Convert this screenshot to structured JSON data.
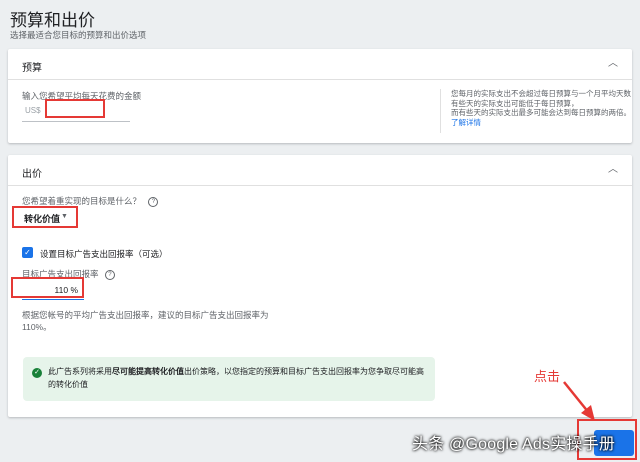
{
  "header": {
    "title": "预算和出价",
    "subtitle": "选择最适合您目标的预算和出价选项"
  },
  "budget": {
    "section_title": "预算",
    "prompt": "输入您希望平均每天花费的金额",
    "currency": "US$",
    "amount_value": "",
    "info_lines": [
      "您每月的实际支出不会超过每日预算与一个月平均天数",
      "有些天的实际支出可能低于每日预算，",
      "而有些天的实际支出最多可能会达到每日预算的两倍。"
    ],
    "learn_more": "了解详情"
  },
  "bidding": {
    "section_title": "出价",
    "goal_question": "您希望着重实现的目标是什么？",
    "goal_value": "转化价值",
    "target_roas_checkbox_label": "设置目标广告支出回报率（可选）",
    "target_roas_label": "目标广告支出回报率",
    "target_roas_value": "110",
    "target_roas_unit": "%",
    "recommendation": "根据您帐号的平均广告支出回报率，建议的目标广告支出回报率为",
    "recommendation_value": "110%。",
    "strategy_prefix": "此广告系列将采用",
    "strategy_name": "尽可能提高转化价值",
    "strategy_suffix": "出价策略，以您指定的预算和目标广告支出回报率为您争取尽可能高的转化价值"
  },
  "annotation": {
    "click_label": "点击"
  },
  "watermark": "头条 @Google Ads实操手册",
  "colors": {
    "accent": "#1a73e8",
    "annotation_red": "#e53935",
    "success_bg": "#e6f4ea",
    "success_icon": "#188038"
  },
  "icons": {
    "collapse": "chevron-up-icon",
    "help": "help-circle-icon",
    "dropdown": "caret-down-icon",
    "checkbox": "check-icon",
    "success": "check-circle-icon"
  }
}
